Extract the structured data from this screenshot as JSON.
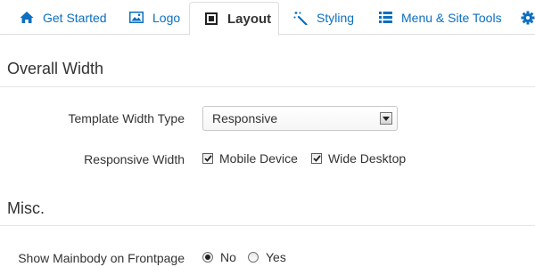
{
  "tabs": [
    {
      "label": "Get Started",
      "icon": "home-icon"
    },
    {
      "label": "Logo",
      "icon": "image-icon"
    },
    {
      "label": "Layout",
      "icon": "layout-square-icon",
      "active": true
    },
    {
      "label": "Styling",
      "icon": "magic-wand-icon"
    },
    {
      "label": "Menu & Site Tools",
      "icon": "list-icon"
    },
    {
      "label": "",
      "icon": "gear-icon"
    }
  ],
  "overall_width": {
    "title": "Overall Width",
    "template_width_type": {
      "label": "Template Width Type",
      "value": "Responsive"
    },
    "responsive_width": {
      "label": "Responsive Width",
      "options": [
        {
          "label": "Mobile Device",
          "checked": true
        },
        {
          "label": "Wide Desktop",
          "checked": true
        }
      ]
    }
  },
  "misc": {
    "title": "Misc.",
    "show_mainbody": {
      "label": "Show Mainbody on Frontpage",
      "options": [
        {
          "label": "No",
          "selected": true
        },
        {
          "label": "Yes",
          "selected": false
        }
      ]
    }
  },
  "colors": {
    "link": "#0c6fbf",
    "text": "#333333",
    "border": "#dddddd"
  }
}
